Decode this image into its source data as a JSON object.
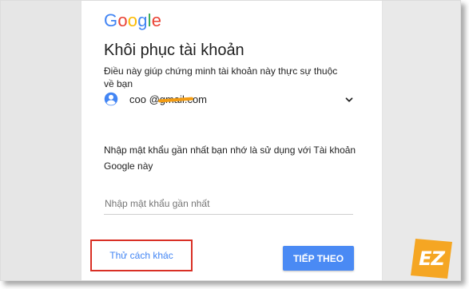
{
  "brand": {
    "letters": [
      "G",
      "o",
      "o",
      "g",
      "l",
      "e"
    ]
  },
  "page": {
    "title": "Khôi phục tài khoản",
    "subtitle": "Điều này giúp chứng minh tài khoản này thực sự thuộc về bạn"
  },
  "account": {
    "email": "coo         @gmail.com",
    "icon": "account-circle-icon",
    "expand_icon": "chevron-down-icon"
  },
  "password_step": {
    "prompt": "Nhập mật khẩu gần nhất bạn nhớ là sử dụng với Tài khoản Google này",
    "input_placeholder": "Nhập mật khẩu gần nhất",
    "input_value": ""
  },
  "actions": {
    "try_another_label": "Thử cách khác",
    "next_label": "TIẾP THEO"
  },
  "watermark": {
    "text": "EZ"
  },
  "colors": {
    "accent": "#4285F4",
    "next_button": "#4a8af4",
    "highlight_border": "#d93025",
    "watermark": "#f5a623"
  }
}
